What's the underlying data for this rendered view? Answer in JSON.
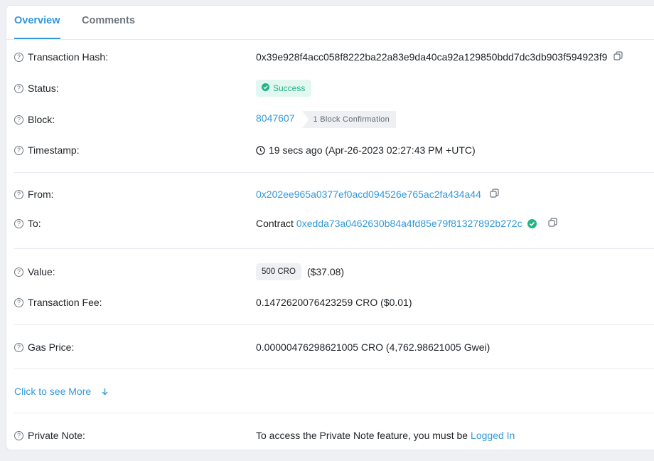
{
  "tabs": [
    {
      "label": "Overview",
      "active": true
    },
    {
      "label": "Comments",
      "active": false
    }
  ],
  "fields": {
    "tx_hash": {
      "label": "Transaction Hash:",
      "value": "0x39e928f4acc058f8222ba22a83e9da40ca92a129850bdd7dc3db903f594923f9"
    },
    "status": {
      "label": "Status:",
      "value": "Success"
    },
    "block": {
      "label": "Block:",
      "value": "8047607",
      "confirmation": "1 Block Confirmation"
    },
    "timestamp": {
      "label": "Timestamp:",
      "value": "19 secs ago (Apr-26-2023 02:27:43 PM +UTC)"
    },
    "from": {
      "label": "From:",
      "value": "0x202ee965a0377ef0acd094526e765ac2fa434a44"
    },
    "to": {
      "label": "To:",
      "prefix": "Contract",
      "value": "0xedda73a0462630b84a4fd85e79f81327892b272c"
    },
    "value": {
      "label": "Value:",
      "amount": "500 CRO",
      "usd": "($37.08)"
    },
    "fee": {
      "label": "Transaction Fee:",
      "value": "0.1472620076423259 CRO ($0.01)"
    },
    "gas_price": {
      "label": "Gas Price:",
      "value": "0.00000476298621005 CRO (4,762.98621005 Gwei)"
    },
    "private_note": {
      "label": "Private Note:",
      "text": "To access the Private Note feature, you must be",
      "link": "Logged In"
    }
  },
  "more": {
    "label": "Click to see More"
  },
  "icons": {
    "help": "question-circle-icon",
    "copy": "copy-icon",
    "clock": "clock-icon",
    "check": "check-circle-icon",
    "arrow": "arrow-down-icon"
  },
  "colors": {
    "link": "#3498db",
    "success": "#20b486",
    "success_bg": "#e2f7ef",
    "tab_active": "#3498db"
  }
}
